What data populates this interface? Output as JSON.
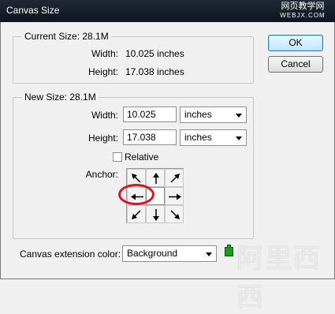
{
  "window": {
    "title": "Canvas Size"
  },
  "watermark": {
    "top_line1": "网页教学网",
    "top_line2": "WEBJX.COM",
    "bottom": "阿里西西"
  },
  "buttons": {
    "ok": "OK",
    "cancel": "Cancel"
  },
  "current_size": {
    "legend": "Current Size: 28.1M",
    "width_label": "Width:",
    "width_value": "10.025 inches",
    "height_label": "Height:",
    "height_value": "17.038 inches"
  },
  "new_size": {
    "legend": "New Size: 28.1M",
    "width_label": "Width:",
    "width_value": "10.025",
    "width_unit": "inches",
    "height_label": "Height:",
    "height_value": "17.038",
    "height_unit": "inches",
    "relative_label": "Relative",
    "relative_checked": false,
    "anchor_label": "Anchor:",
    "anchor_selected": "center"
  },
  "extension": {
    "label": "Canvas extension color:",
    "value": "Background",
    "swatch_color": "#18a018"
  },
  "icons": {
    "anchor": [
      "arrow-up-left-icon",
      "arrow-up-icon",
      "arrow-up-right-icon",
      "arrow-left-icon",
      "anchor-center",
      "arrow-right-icon",
      "arrow-down-left-icon",
      "arrow-down-icon",
      "arrow-down-right-icon"
    ]
  }
}
